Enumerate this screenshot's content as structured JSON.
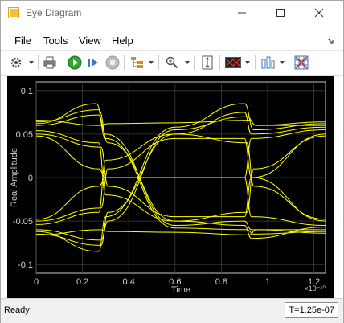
{
  "window": {
    "title": "Eye Diagram"
  },
  "menu": [
    "File",
    "Tools",
    "View",
    "Help"
  ],
  "toolbar": {
    "buttons": [
      "settings-icon",
      "print-icon",
      "run-icon",
      "step-forward-icon",
      "stop-icon",
      "signal-hierarchy-icon",
      "zoom-icon",
      "scale-axes-icon",
      "measurement-icon",
      "histogram-icon",
      "grid-toggle-icon"
    ]
  },
  "chart_data": {
    "type": "line",
    "title": "",
    "xlabel": "Time",
    "ylabel": "Real Amplitude",
    "x_multiplier": "×10⁻¹⁰",
    "xlim": [
      0,
      1.25
    ],
    "ylim": [
      -0.11,
      0.11
    ],
    "x_ticks": [
      "0",
      "0.2",
      "0.4",
      "0.6",
      "0.8",
      "1",
      "1.2"
    ],
    "y_ticks": [
      "-0.1",
      "-0.05",
      "0",
      "0.05",
      "0.1"
    ],
    "grid": true,
    "trace_color": "#ffff00",
    "series": [
      {
        "x": [
          0,
          0.27,
          0.3,
          0.6,
          0.9,
          0.93,
          1.25
        ],
        "y": [
          0.06,
          0.072,
          0.05,
          -0.055,
          -0.05,
          -0.06,
          -0.06
        ]
      },
      {
        "x": [
          0,
          0.26,
          0.3,
          0.6,
          0.91,
          0.94,
          1.25
        ],
        "y": [
          0.062,
          0.085,
          0.045,
          -0.058,
          -0.06,
          -0.065,
          -0.062
        ]
      },
      {
        "x": [
          0,
          0.27,
          0.31,
          0.6,
          0.9,
          0.93,
          1.25
        ],
        "y": [
          0.064,
          0.078,
          0.04,
          -0.05,
          -0.055,
          -0.07,
          -0.057
        ]
      },
      {
        "x": [
          0,
          0.28,
          0.31,
          0.6,
          0.91,
          0.95,
          1.25
        ],
        "y": [
          -0.06,
          -0.072,
          -0.05,
          0.055,
          0.07,
          0.06,
          0.06
        ]
      },
      {
        "x": [
          0,
          0.27,
          0.3,
          0.6,
          0.9,
          0.94,
          1.25
        ],
        "y": [
          -0.062,
          -0.085,
          -0.045,
          0.058,
          0.085,
          0.055,
          0.062
        ]
      },
      {
        "x": [
          0,
          0.28,
          0.31,
          0.6,
          0.9,
          0.93,
          1.25
        ],
        "y": [
          -0.065,
          -0.078,
          -0.04,
          0.05,
          0.075,
          0.05,
          0.058
        ]
      },
      {
        "x": [
          0,
          0.28,
          0.31,
          0.6,
          0.9,
          0.93,
          1.25
        ],
        "y": [
          0.05,
          0.035,
          -0.01,
          -0.045,
          -0.045,
          0.0,
          0.05
        ]
      },
      {
        "x": [
          0,
          0.27,
          0.3,
          0.6,
          0.91,
          0.94,
          1.25
        ],
        "y": [
          0.054,
          0.04,
          -0.02,
          -0.05,
          -0.04,
          0.01,
          0.048
        ]
      },
      {
        "x": [
          0,
          0.28,
          0.31,
          0.6,
          0.9,
          0.93,
          1.25
        ],
        "y": [
          -0.05,
          -0.035,
          0.01,
          0.045,
          0.045,
          0.0,
          -0.05
        ]
      },
      {
        "x": [
          0,
          0.27,
          0.3,
          0.6,
          0.91,
          0.94,
          1.25
        ],
        "y": [
          -0.054,
          -0.04,
          0.02,
          0.05,
          0.04,
          -0.01,
          -0.048
        ]
      },
      {
        "x": [
          0,
          0.27,
          0.3,
          0.6,
          0.9,
          0.93,
          1.25
        ],
        "y": [
          0.048,
          0.01,
          0.0,
          0.0,
          0.0,
          0.045,
          0.055
        ]
      },
      {
        "x": [
          0,
          0.27,
          0.3,
          0.6,
          0.9,
          0.93,
          1.25
        ],
        "y": [
          -0.048,
          -0.01,
          0.0,
          0.0,
          0.0,
          -0.045,
          -0.055
        ]
      },
      {
        "x": [
          0,
          0.28,
          0.31,
          0.6,
          0.92,
          0.95,
          1.25
        ],
        "y": [
          0.066,
          0.06,
          0.062,
          0.063,
          0.066,
          0.06,
          0.064
        ]
      },
      {
        "x": [
          0,
          0.28,
          0.31,
          0.6,
          0.92,
          0.95,
          1.25
        ],
        "y": [
          -0.066,
          -0.06,
          -0.062,
          -0.063,
          -0.066,
          -0.06,
          -0.064
        ]
      }
    ]
  },
  "status": {
    "text": "Ready",
    "time": "T=1.25e-07"
  }
}
